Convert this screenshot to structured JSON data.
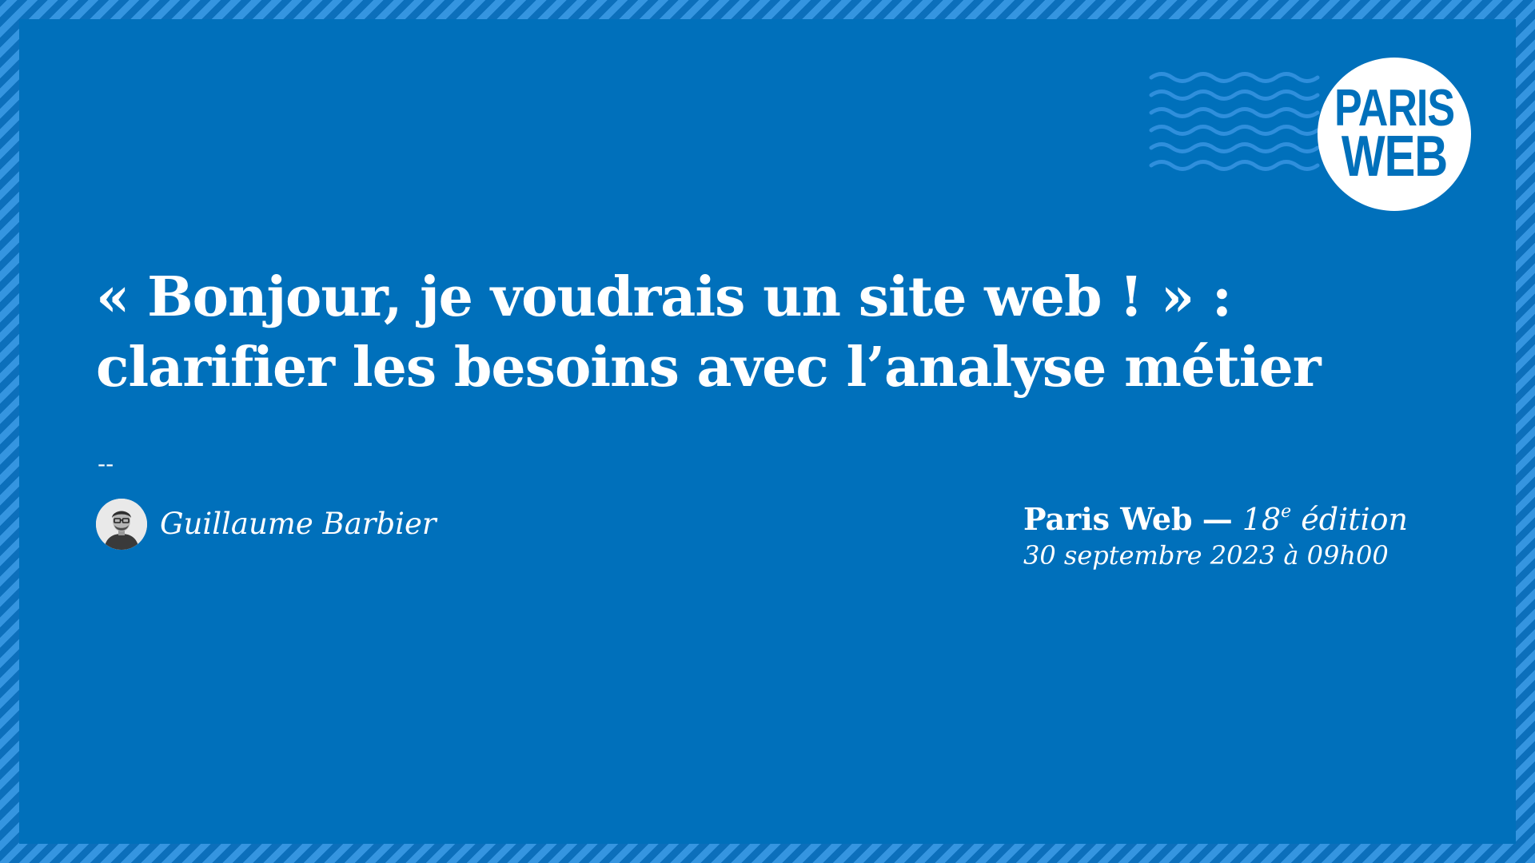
{
  "brand": {
    "logo_line1": "PARIS",
    "logo_line2": "WEB",
    "color_background": "#0070bb",
    "color_stripe_light": "#3595e0",
    "color_stripe_dark": "#0c6fbb",
    "color_waves": "#2f8fdc",
    "color_text": "#ffffff",
    "decoration": "wave-lines-icon"
  },
  "talk": {
    "title_line1": "« Bonjour, je voudrais un site web ! » :",
    "title_line2": "clarifier les besoins avec l’analyse métier",
    "separator": "--",
    "speaker_name": "Guillaume Barbier"
  },
  "event": {
    "name": "Paris Web",
    "dash": "—",
    "edition_number": "18",
    "edition_suffix": "e",
    "edition_word": "édition",
    "date": "30 septembre 2023 à 09h00"
  }
}
